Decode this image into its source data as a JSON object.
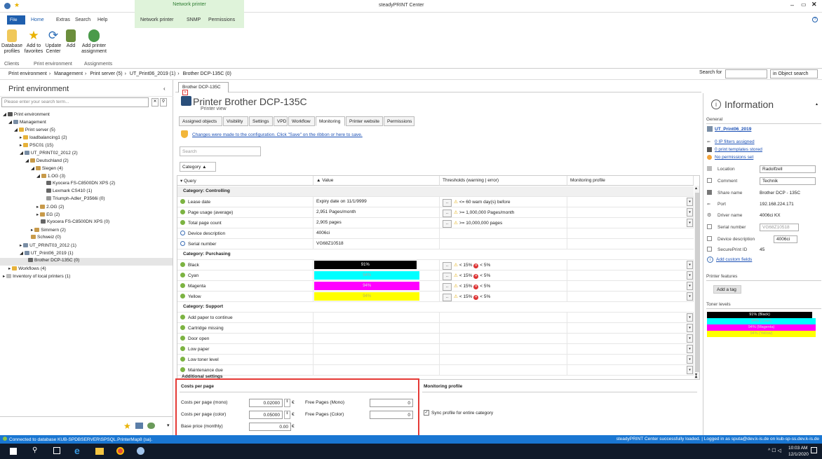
{
  "window": {
    "title": "steadyPRINT Center",
    "context_group": "Network printer"
  },
  "menu_tabs": [
    "File",
    "Home",
    "Extras",
    "Search",
    "Help"
  ],
  "context_tabs": [
    "Network printer",
    "SNMP",
    "Permissions"
  ],
  "ribbon": {
    "buttons": [
      {
        "label": "Database profiles"
      },
      {
        "label": "Add to favorites"
      },
      {
        "label": "Update Center"
      },
      {
        "label": "Add"
      },
      {
        "label": "Add printer assignment"
      }
    ],
    "groups": [
      "Clients",
      "Print environment",
      "Assignments"
    ]
  },
  "breadcrumb": [
    "Print environment",
    "Management",
    "Print server (5)",
    "UT_Print06_2019 (1)",
    "Brother DCP-135C (0)"
  ],
  "search": {
    "label": "Search for",
    "scope": "in  Object search"
  },
  "left_panel": {
    "title": "Print environment",
    "search_placeholder": "Please enter your search term...",
    "tree": [
      "Print environment",
      "Management",
      "Print server (5)",
      "loadbalancing1 (2)",
      "PSC01 (15)",
      "UT_PRINT02_2012 (2)",
      "Deutschland (2)",
      "Siegen (4)",
      "1.OG (3)",
      "Kyocera FS-C8500DN XPS (2)",
      "Lexmark CS410 (1)",
      "Triumph-Adler_P3566i (0)",
      "2.OG (2)",
      "EG (2)",
      "Kyocera FS-C8500DN XPS (0)",
      "Simmern (2)",
      "Schweiz (0)",
      "UT_PRINT03_2012 (1)",
      "UT_Print06_2019 (1)",
      "Brother DCP-135C (0)",
      "Workflows (4)",
      "Inventory of local printers (1)"
    ]
  },
  "doc_tab": "Brother DCP-135C",
  "printer": {
    "title": "Printer Brother DCP-135C",
    "subtitle": "Printer view"
  },
  "sub_tabs": [
    "Assigned objects",
    "Visibility",
    "Settings",
    "VPD",
    "Workflow",
    "Monitoring",
    "Printer website",
    "Permissions"
  ],
  "notice": "Changes were made to the configuration. Click \"Save\" on the ribbon or here to save.",
  "center_search_placeholder": "Search",
  "category_button": "Category",
  "grid_headers": [
    "Query",
    "Value",
    "Thresholds (warning | error)",
    "Monitoring profile"
  ],
  "categories": {
    "controlling": "Category: Controlling",
    "purchasing": "Category: Purchasing",
    "support": "Category: Support"
  },
  "rows_controlling": [
    {
      "query": "Lease date",
      "value": "Expiry date on 11/1/9999",
      "threshold": "<= 60 warn day(s) before"
    },
    {
      "query": "Page usage (average)",
      "value": "2,951 Pages/month",
      "threshold": ">= 1,000,000 Pages/month"
    },
    {
      "query": "Total page count",
      "value": "2,905 pages",
      "threshold": ">= 10,000,000 pages"
    },
    {
      "query": "Device description",
      "value": "4006ci",
      "threshold": ""
    },
    {
      "query": "Serial number",
      "value": "VG68Z10518",
      "threshold": ""
    }
  ],
  "toner": [
    {
      "name": "Black",
      "percent": 91,
      "label": "91%",
      "color": "#000000",
      "text": "#ffffff"
    },
    {
      "name": "Cyan",
      "percent": 94,
      "label": "94%",
      "color": "#00ffff",
      "text": "#aaaaaa"
    },
    {
      "name": "Magenta",
      "percent": 94,
      "label": "94%",
      "color": "#ff00ff",
      "text": "#dddddd"
    },
    {
      "name": "Yellow",
      "percent": 94,
      "label": "94%",
      "color": "#ffff00",
      "text": "#bbbb55"
    }
  ],
  "toner_thresholds": {
    "warn": "< 15%",
    "err": "< 5%"
  },
  "rows_support": [
    "Add paper to continue",
    "Cartridge missing",
    "Door open",
    "Low paper",
    "Low toner level",
    "Maintenance due"
  ],
  "additional_settings": "Additional settings",
  "costs": {
    "title": "Costs per page",
    "mono_label": "Costs per page (mono)",
    "mono_value": "0.02000",
    "color_label": "Costs per page (color)",
    "color_value": "0.05000",
    "base_label": "Base price (monthly)",
    "base_value": "0.00",
    "currency": "€",
    "free_mono_label": "Free Pages (Mono)",
    "free_mono_value": "0",
    "free_color_label": "Free Pages (Color)",
    "free_color_value": "0"
  },
  "monitoring_profile": {
    "title": "Monitoring profile",
    "sync_label": "Sync profile for entire category"
  },
  "info": {
    "title": "Information",
    "general": "General",
    "server": "UT_Print06_2019",
    "ip_filters": "0 IP filters assigned",
    "templates": "0 print templates stored",
    "permissions": "No permissions set",
    "location_label": "Location",
    "location_value": "Radolfzell",
    "comment_label": "Comment",
    "comment_value": "Technik",
    "share_label": "Share name",
    "share_value": "Brother DCP - 135C",
    "port_label": "Port",
    "port_value": "192.168.224.171",
    "driver_label": "Driver name",
    "driver_value": "4006ci KX",
    "serial_label": "Serial number",
    "serial_value": "VG68Z10518",
    "devdesc_label": "Device description",
    "devdesc_value": "4006ci",
    "spid_label": "SecurePrint ID",
    "spid_value": "45",
    "custom_fields": "Add custom fields",
    "features": "Printer features",
    "add_tag": "Add a tag",
    "toner_levels": "Toner levels",
    "toner_labels": [
      "91% (Black)",
      "94% (Cyan)",
      "94% (Magenta)",
      "94% (Yellow)"
    ]
  },
  "status": {
    "left": "Connected to database KUB-SPDBSERVER\\SPSQL.PrinterMap8 (sa).",
    "right": "steadyPRINT Center successfully loaded. | Logged in as sputa@dev.k-is.de on kub-sp-ss.dev.k-is.de"
  },
  "clock": {
    "time": "10:03 AM",
    "date": "12/1/2020"
  }
}
